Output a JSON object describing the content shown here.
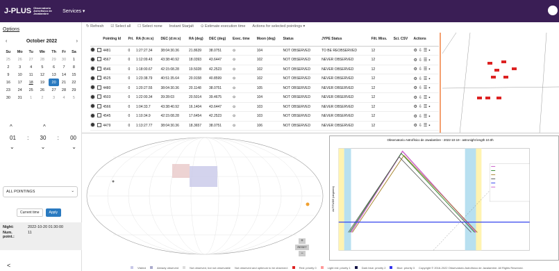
{
  "nav": {
    "brand": "J-PLUS",
    "brand_sub": "Observatorio Astrofísico de Javalambre",
    "menu": "Services ▾"
  },
  "sidebar": {
    "options": "Options",
    "month": "October 2022",
    "prev": "‹",
    "next": "›",
    "days": [
      "Su",
      "Mo",
      "Tu",
      "We",
      "Th",
      "Fr",
      "Sa"
    ],
    "weeks": [
      [
        "25",
        "26",
        "27",
        "28",
        "29",
        "30",
        "1"
      ],
      [
        "2",
        "3",
        "4",
        "5",
        "6",
        "7",
        "8"
      ],
      [
        "9",
        "10",
        "11",
        "12",
        "13",
        "14",
        "15"
      ],
      [
        "16",
        "17",
        "18",
        "19",
        "20",
        "21",
        "22"
      ],
      [
        "23",
        "24",
        "25",
        "26",
        "27",
        "28",
        "29"
      ],
      [
        "30",
        "31",
        "1",
        "2",
        "3",
        "4",
        "5"
      ]
    ],
    "hour": "01",
    "minute": "30",
    "second": "00",
    "sep": ":",
    "up": "^",
    "down": "⌄",
    "select": "ALL POINTINGS",
    "current_time": "Current time",
    "apply": "Apply",
    "night_label": "Night:",
    "night": "2022-10-20 01:30:00",
    "num_label": "Num. point.:",
    "num": "11",
    "collapse": "<"
  },
  "toolbar": [
    "↻ Refresh",
    "☑ Select all",
    "☐ Select none",
    "Instant Starjalt",
    "⊙ Estimate execution time",
    "Actions for selected pointings ▾"
  ],
  "table": {
    "headers": [
      "",
      "",
      "Pointing Id",
      "Pri.",
      "RA (h:m:s)",
      "DEC (d:m:s)",
      "RA (deg)",
      "DEC (deg)",
      "Exec. time",
      "Moon (deg)",
      "Status",
      "JYPE Status",
      "Filt. Miss.",
      "Sci. CSV",
      "Actions"
    ],
    "rows": [
      [
        "4481",
        "0",
        "1:27:27.34",
        "38:04:30.36",
        "21.8639",
        "38.0751",
        "104",
        "NOT OBSERVED",
        "TO BE REOBSERVED",
        "12"
      ],
      [
        "4567",
        "0",
        "1:12:09.43",
        "43:38:40.92",
        "18.0393",
        "43.6447",
        "102",
        "NOT OBSERVED",
        "NEVER OBSERVED",
        "12"
      ],
      [
        "4546",
        "0",
        "1:18:00.67",
        "42:15:08.28",
        "19.5028",
        "42.2523",
        "102",
        "NOT OBSERVED",
        "NEVER OBSERVED",
        "12"
      ],
      [
        "4525",
        "0",
        "1:23:38.79",
        "40:51:35.64",
        "20.9158",
        "40.8599",
        "102",
        "NOT OBSERVED",
        "NEVER OBSERVED",
        "12"
      ],
      [
        "4480",
        "0",
        "1:20:27.55",
        "38:04:30.36",
        "20.1148",
        "38.0751",
        "105",
        "NOT OBSERVED",
        "NEVER OBSERVED",
        "12"
      ],
      [
        "4503",
        "0",
        "1:22:00.34",
        "39:28:03",
        "20.5014",
        "39.4675",
        "104",
        "NOT OBSERVED",
        "NEVER OBSERVED",
        "12"
      ],
      [
        "4566",
        "0",
        "1:04:33.7",
        "43:38:40.92",
        "16.1404",
        "43.6447",
        "103",
        "NOT OBSERVED",
        "NEVER OBSERVED",
        "12"
      ],
      [
        "4545",
        "0",
        "1:10:34.9",
        "42:15:08.28",
        "17.6454",
        "42.2523",
        "103",
        "NOT OBSERVED",
        "NEVER OBSERVED",
        "12"
      ],
      [
        "4479",
        "0",
        "1:13:27.77",
        "38:04:30.36",
        "18.3657",
        "38.0751",
        "106",
        "NOT OBSERVED",
        "NEVER OBSERVED",
        "12"
      ]
    ]
  },
  "vis_title": "Observatorio Astrofísico de Javalambre - 2022-10-19 - astronight length 10.0h",
  "vis_ylabel": "ALTITUDE (degrees)",
  "footer": [
    "Visited",
    "Already observed",
    "Not observed, but not observable",
    "Not observed and optimum to be observed:",
    "Red: priority 0",
    "Light red: priority 1",
    "Dark blue: priority 2",
    "Blue: priority 3",
    "Copyright © 2016-2022 Observatorio Astrofísico de Javalambre. All Rights Reserved."
  ],
  "zoom": {
    "plus": "+",
    "reset": "RESET",
    "minus": "−"
  }
}
